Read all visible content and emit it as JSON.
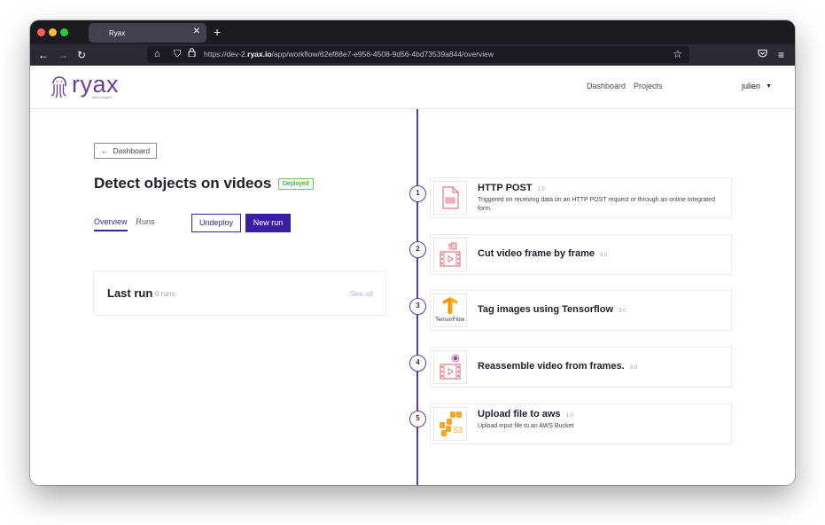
{
  "browser": {
    "tab_title": "Ryax",
    "url_prefix": "https://dev-2.",
    "url_domain": "ryax.io",
    "url_path": "/app/workflow/62ef88e7-e956-4508-9d56-4bd73539a844/overview"
  },
  "header": {
    "logo_text": "ryax",
    "logo_subtext": "technologies",
    "nav": [
      "Dashboard",
      "Projects"
    ],
    "user": "julien"
  },
  "page": {
    "back_label": "Dashboard",
    "title": "Detect objects on videos",
    "status": "Deployed",
    "tabs": [
      "Overview",
      "Runs"
    ],
    "undeploy_label": "Undeploy",
    "new_run_label": "New run",
    "last_run": {
      "title": "Last run",
      "count": "0 runs",
      "see_all": "See all"
    }
  },
  "workflow": {
    "steps": [
      {
        "number": "1",
        "title": "HTTP POST",
        "version": "1.5",
        "description": "Triggered on receiving data on an HTTP POST request or through an online integrated form.",
        "icon": "document-icon"
      },
      {
        "number": "2",
        "title": "Cut video frame by frame",
        "version": "3.0",
        "description": "",
        "icon": "film-frames-icon"
      },
      {
        "number": "3",
        "title": "Tag images using Tensorflow",
        "version": "3.0",
        "description": "",
        "icon": "tensorflow-icon",
        "icon_label": "TensorFlow"
      },
      {
        "number": "4",
        "title": "Reassemble video from frames.",
        "version": "3.0",
        "description": "",
        "icon": "film-record-icon"
      },
      {
        "number": "5",
        "title": "Upload file to aws",
        "version": "1.0",
        "description": "Upload input file to an AWS Bucket",
        "icon": "aws-s3-icon",
        "icon_label": "S3"
      }
    ]
  },
  "colors": {
    "primary": "#3a1fa0",
    "timeline": "#5b3aa6",
    "deployed": "#3a8e27",
    "logo": "#6a3f8e"
  }
}
